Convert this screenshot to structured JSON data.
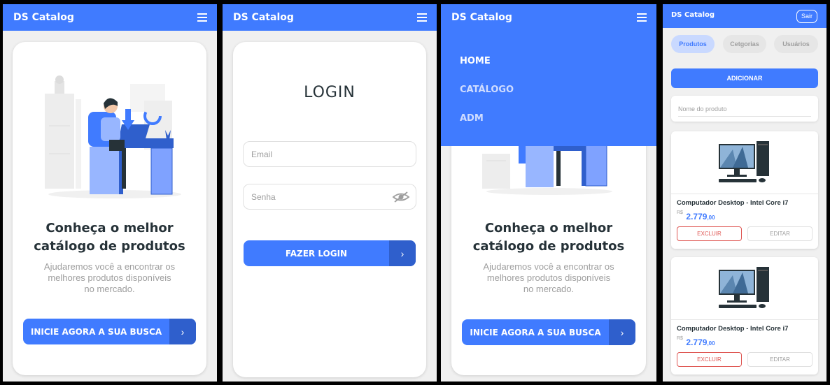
{
  "app": {
    "brand": "DS Catalog"
  },
  "home": {
    "title_line1": "Conheça o melhor",
    "title_line2": "catálogo de produtos",
    "subtitle_line1": "Ajudaremos você a encontrar os",
    "subtitle_line2": "melhores produtos disponíveis",
    "subtitle_line3": "no mercado.",
    "cta_label": "INICIE AGORA A SUA BUSCA",
    "cta_arrow": "›"
  },
  "login": {
    "title": "LOGIN",
    "email_placeholder": "Email",
    "password_placeholder": "Senha",
    "submit_label": "FAZER LOGIN",
    "submit_arrow": "›"
  },
  "menu": {
    "items": [
      {
        "label": "HOME",
        "active": true
      },
      {
        "label": "CATÁLOGO",
        "active": false
      },
      {
        "label": "ADM",
        "active": false
      }
    ]
  },
  "admin": {
    "logout_label": "Sair",
    "tabs": [
      {
        "label": "Produtos",
        "active": true
      },
      {
        "label": "Cetgorias",
        "active": false
      },
      {
        "label": "Usuários",
        "active": false
      }
    ],
    "add_label": "ADICIONAR",
    "search_placeholder": "Nome do produto",
    "products": [
      {
        "name": "Computador Desktop - Intel Core i7",
        "currency": "R$",
        "price": "2.779",
        "cents": ",00",
        "delete_label": "EXCLUIR",
        "edit_label": "EDITAR"
      },
      {
        "name": "Computador Desktop - Intel Core i7",
        "currency": "R$",
        "price": "2.779",
        "cents": ",00",
        "delete_label": "EXCLUIR",
        "edit_label": "EDITAR"
      }
    ]
  },
  "colors": {
    "primary": "#407bff",
    "primary_dark": "#2f5fcc",
    "danger": "#df5753",
    "text_dark": "#263238",
    "text_muted": "#9e9e9e",
    "menu_inactive": "#cfdcff"
  },
  "icons": {
    "menu": "hamburger-icon",
    "arrow": "chevron-right-icon",
    "eye": "eye-off-icon",
    "hero": "office-illustration",
    "product": "desktop-computer-image"
  }
}
